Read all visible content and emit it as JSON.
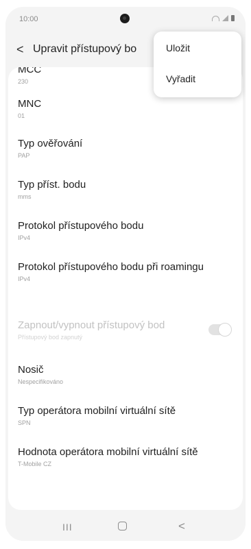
{
  "status_bar": {
    "time": "10:00"
  },
  "app_bar": {
    "back_icon": "chevron-left-icon",
    "title": "Upravit přístupový bo"
  },
  "overflow_menu": {
    "items": [
      {
        "label": "Uložit"
      },
      {
        "label": "Vyřadit"
      }
    ]
  },
  "settings": [
    {
      "title": "MCC",
      "value": "230"
    },
    {
      "title": "MNC",
      "value": "01"
    },
    {
      "title": "Typ ověřování",
      "value": "PAP"
    },
    {
      "title": "Typ příst. bodu",
      "value": "mms"
    },
    {
      "title": "Protokol přístupového bodu",
      "value": "IPv4"
    },
    {
      "title": "Protokol přístupového bodu při roamingu",
      "value": "IPv4"
    },
    {
      "title": "Zapnout/vypnout přístupový bod",
      "value": "Přístupový bod zapnutý",
      "disabled": true
    },
    {
      "title": "Nosič",
      "value": "Nespecifikováno"
    },
    {
      "title": "Typ operátora mobilní virtuální sítě",
      "value": "SPN"
    },
    {
      "title": "Hodnota operátora mobilní virtuální sítě",
      "value": "T-Mobile CZ"
    }
  ],
  "nav_bar": {
    "recent_icon": "recent-apps-icon",
    "home_icon": "home-icon",
    "back_icon": "back-icon"
  },
  "colors": {
    "background": "#f4f4f4",
    "card": "#ffffff",
    "text_primary": "#202020",
    "text_secondary": "#a0a0a0"
  }
}
